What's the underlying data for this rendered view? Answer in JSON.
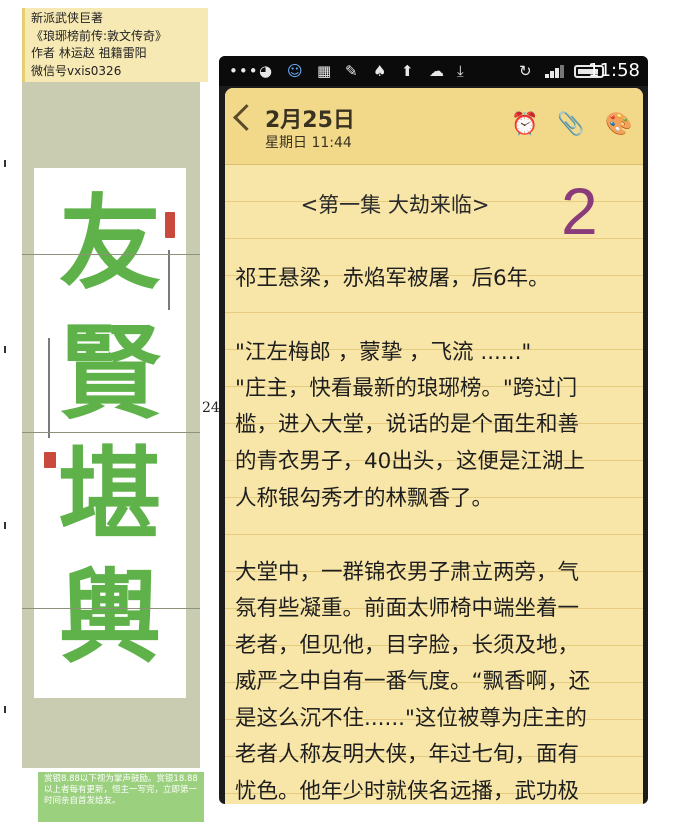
{
  "header_note": {
    "lines": [
      "新派武侠巨著",
      "《琅琊榜前传:敦文传奇》",
      "作者 林运赵 祖籍雷阳",
      "微信号vxis0326"
    ]
  },
  "painting": {
    "characters": [
      "友",
      "賢",
      "堪",
      "輿"
    ]
  },
  "page_number": "24",
  "reward_text": "赏银8.88以下视为掌声鼓励。赏银18.88以上者每有更新，恒主一写完，立即第一时间亲自首发给友。",
  "status_bar": {
    "time": "11:58",
    "icons": [
      "menu-dots-icon",
      "wechat-icon",
      "contact-icon",
      "grid-icon",
      "clean-icon",
      "location-icon",
      "upload-icon",
      "cloud-icon",
      "download-icon",
      "sync-icon",
      "signal-icon",
      "battery-icon"
    ]
  },
  "note_app": {
    "date": "2月25日",
    "weekday_time": "星期日 11:44",
    "episode_title": "<第一集 大劫来临>",
    "episode_number": "2",
    "lines": [
      "祁王悬梁，赤焰军被屠，后6年。",
      "\"江左梅郎 ，蒙挚 ，飞流 ......\"",
      "\"庄主，快看最新的琅琊榜。\"跨过门",
      "槛，进入大堂，说话的是个面生和善",
      "的青衣男子，40出头，这便是江湖上",
      "人称银勾秀才的林飘香了。",
      "大堂中，一群锦衣男子肃立两旁，气",
      "氛有些凝重。前面太师椅中端坐着一",
      "老者，但见他，目字脸，长须及地，",
      "威严之中自有一番气度。“飘香啊，还",
      "是这么沉不住......\"这位被尊为庄主的",
      "老者人称友明大侠，年过七旬，面有",
      "忧色。他年少时就侠名远播，武功极"
    ],
    "colors": {
      "paper": "#f8e6a8",
      "header": "#f2d98a",
      "episode_number": "#8a3b7a"
    }
  }
}
